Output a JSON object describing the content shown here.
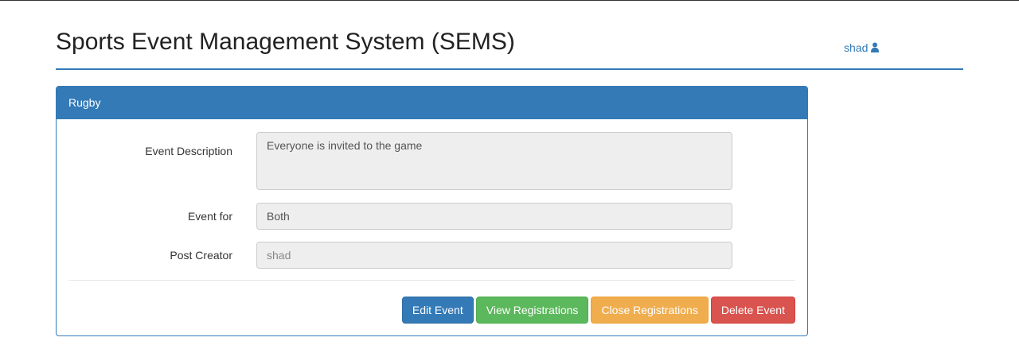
{
  "header": {
    "title": "Sports Event Management System (SEMS)",
    "user_name": "shad",
    "user_icon": "user-icon"
  },
  "panel": {
    "title": "Rugby",
    "fields": {
      "description_label": "Event Description",
      "description_value": "Everyone is invited to the game",
      "event_for_label": "Event for",
      "event_for_value": "Both",
      "creator_label": "Post Creator",
      "creator_placeholder": "shad"
    },
    "actions": {
      "edit": "Edit Event",
      "view_registrations": "View Registrations",
      "close_registrations": "Close Registrations",
      "delete": "Delete Event"
    }
  },
  "colors": {
    "primary": "#337ab7",
    "success": "#5cb85c",
    "warning": "#f0ad4e",
    "danger": "#d9534f"
  }
}
